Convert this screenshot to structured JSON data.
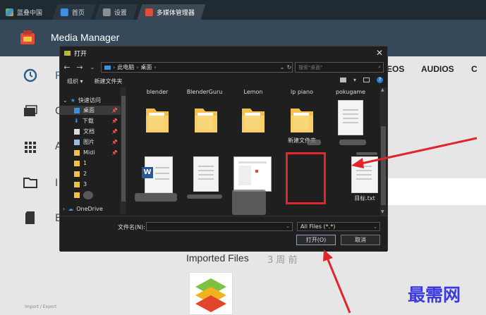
{
  "browser": {
    "tabs": [
      {
        "label": "蓝叠中国"
      },
      {
        "label": "首页"
      },
      {
        "label": "设置"
      },
      {
        "label": "多媒体管理器"
      }
    ]
  },
  "app": {
    "title": "Media Manager",
    "tab_videos": "EOS",
    "tab_audios": "AUDIOS",
    "tab_more": "C",
    "nav_letters": [
      "P",
      "C",
      "A",
      "I",
      "E"
    ],
    "imported_label": "Imported Files",
    "imported_when": "3 周 前",
    "import_export": "Import / Export"
  },
  "dialog": {
    "title": "打开",
    "address": [
      "此电脑",
      "桌面"
    ],
    "search_placeholder": "搜索\"桌面\"",
    "toolbar": {
      "organize": "组织 ▾",
      "new_folder": "新建文件夹"
    },
    "nav": {
      "quick_access": "快速访问",
      "items": [
        "桌面",
        "下载",
        "文档",
        "图片",
        "Midi",
        "1",
        "2",
        "3"
      ],
      "onedrive": "OneDrive"
    },
    "files_row1": [
      "blender",
      "BlenderGuru",
      "Lemon",
      "lp piano",
      "pokugame"
    ],
    "folder_label": "新建文件夹",
    "target_file": "目标.txt",
    "filename_label": "文件名(N):",
    "filetype": "All Files (*.*)",
    "open_button": "打开(O)",
    "cancel_button": "取消"
  },
  "watermark": "最需网"
}
